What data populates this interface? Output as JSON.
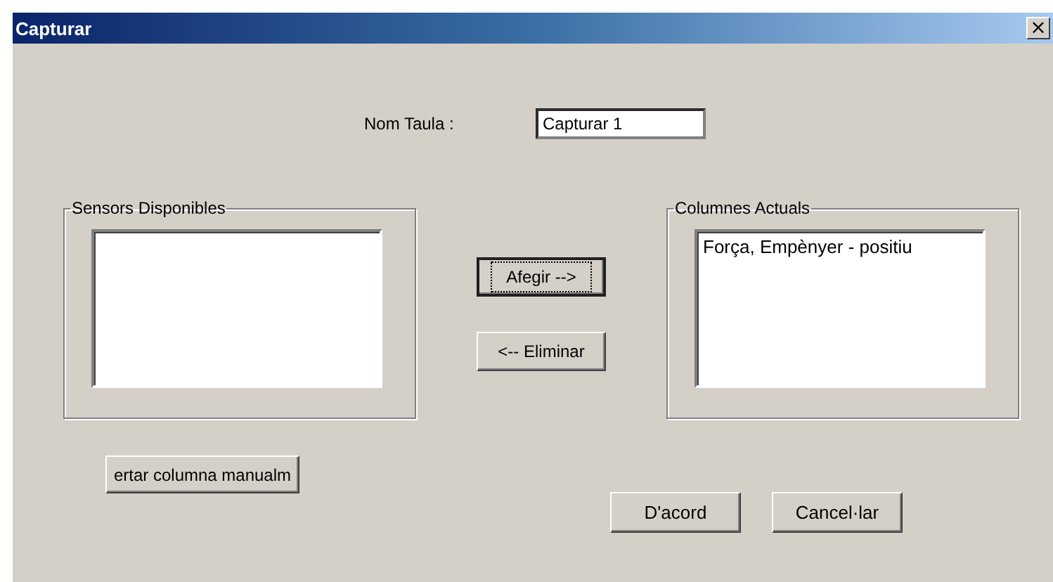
{
  "window": {
    "title": "Capturar",
    "close": "×"
  },
  "name_field": {
    "label": "Nom Taula :",
    "value": "Capturar 1"
  },
  "available": {
    "title": "Sensors Disponibles"
  },
  "move_buttons": [
    {
      "label": "Afegir -->",
      "focused": true
    },
    {
      "label": "<-- Eliminar",
      "focused": false
    }
  ],
  "current": {
    "title": "Columnes Actuals",
    "items": [
      {
        "label": "Força, Empènyer - positiu",
        "selected": false
      }
    ]
  },
  "manual_button": "ertar columna manualm",
  "buttons": [
    "D'acord",
    "Cancel·lar"
  ]
}
